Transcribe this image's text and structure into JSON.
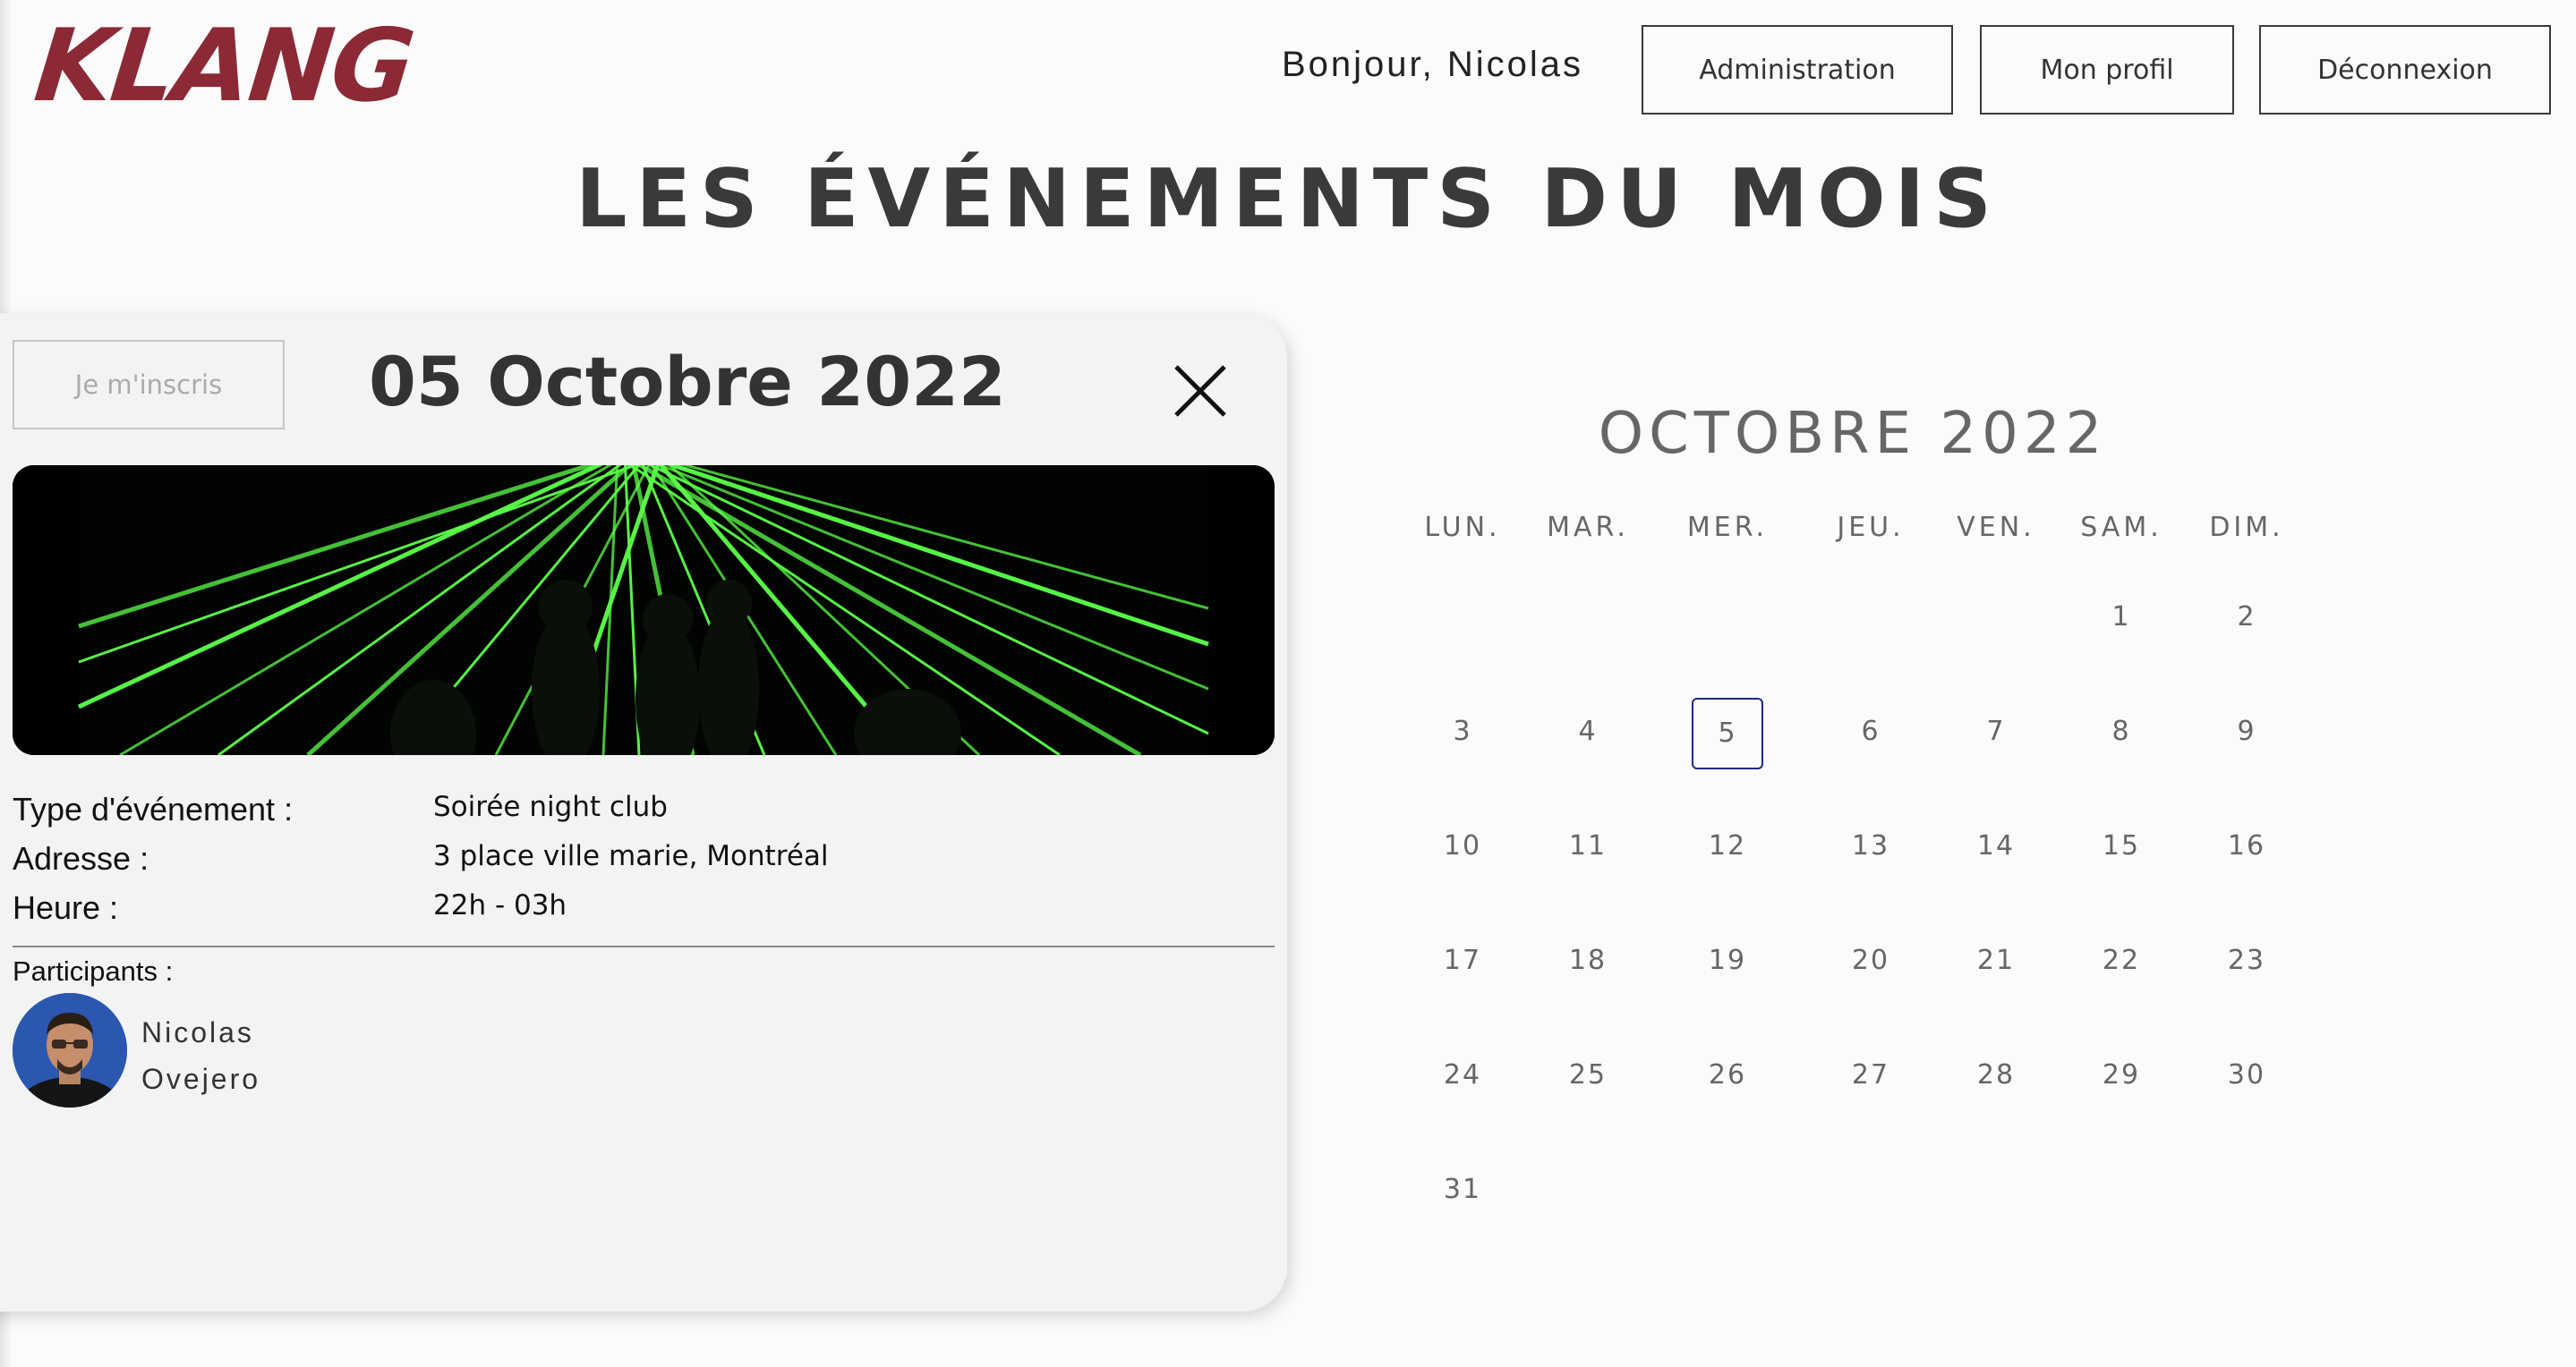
{
  "header": {
    "logo": "KLANG",
    "greeting": "Bonjour, Nicolas",
    "buttons": {
      "admin": "Administration",
      "profile": "Mon profil",
      "logout": "Déconnexion"
    }
  },
  "page_title": "LES ÉVÉNEMENTS DU MOIS",
  "event": {
    "signup_label": "Je m'inscris",
    "date": "05 Octobre 2022",
    "image_desc": "green-laser-club-photo",
    "details": {
      "type_label": "Type d'événement :",
      "type_value": "Soirée night club",
      "address_label": "Adresse :",
      "address_value": "3 place ville marie, Montréal",
      "time_label": "Heure :",
      "time_value": "22h - 03h"
    },
    "participants_label": "Participants :",
    "participants": [
      {
        "first_name": "Nicolas",
        "last_name": "Ovejero"
      }
    ]
  },
  "calendar": {
    "title": "OCTOBRE 2022",
    "weekdays": [
      "LUN.",
      "MAR.",
      "MER.",
      "JEU.",
      "VEN.",
      "SAM.",
      "DIM."
    ],
    "selected_day": "5",
    "rows": [
      [
        "",
        "",
        "",
        "",
        "",
        "1",
        "2"
      ],
      [
        "3",
        "4",
        "5",
        "6",
        "7",
        "8",
        "9"
      ],
      [
        "10",
        "11",
        "12",
        "13",
        "14",
        "15",
        "16"
      ],
      [
        "17",
        "18",
        "19",
        "20",
        "21",
        "22",
        "23"
      ],
      [
        "24",
        "25",
        "26",
        "27",
        "28",
        "29",
        "30"
      ],
      [
        "31",
        "",
        "",
        "",
        "",
        "",
        ""
      ]
    ]
  },
  "colors": {
    "logo": "#8b2a36",
    "selected_border": "#1f2a8a",
    "laser": "#5cff4a"
  }
}
